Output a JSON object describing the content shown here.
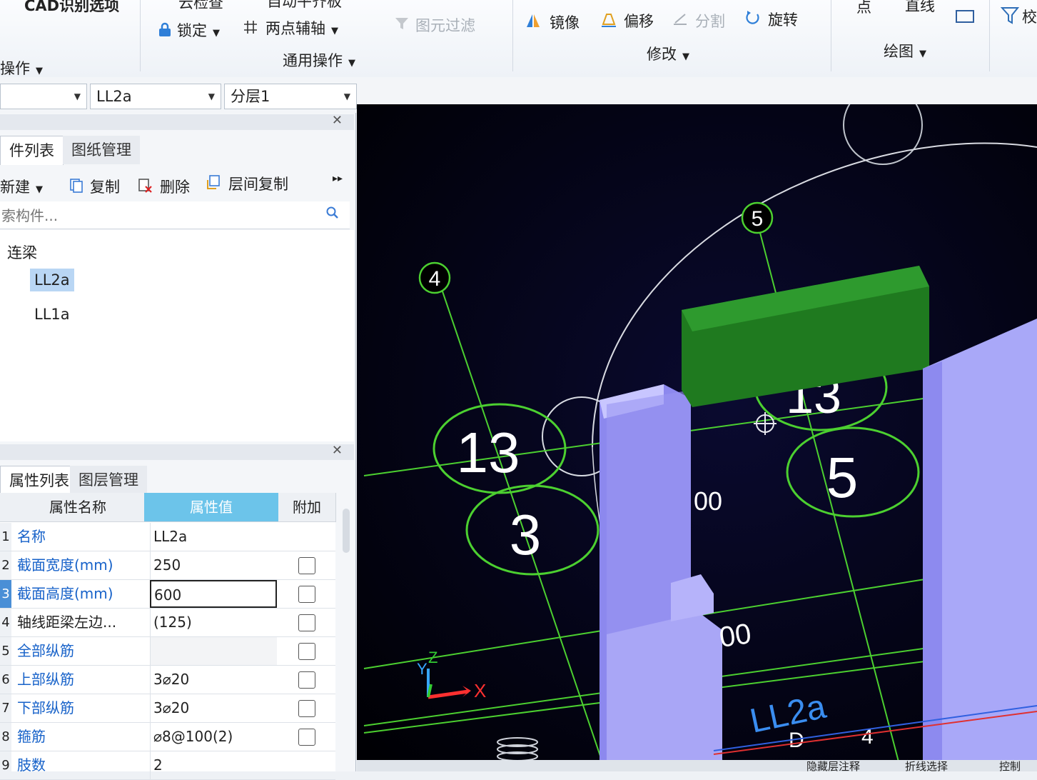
{
  "ribbon": {
    "partial_top_left": "CAD识别选项",
    "partial_top_check": "云检查",
    "partial_top_auto": "自动平齐板",
    "group_left_label": "操作",
    "lock_label": "锁定",
    "two_point_axis_label": "两点辅轴",
    "general_ops_label": "通用操作",
    "filter_label": "图元过滤",
    "mirror_label": "镜像",
    "offset_label": "偏移",
    "split_label": "分割",
    "rotate_label": "旋转",
    "modify_label": "修改",
    "point_label": "点",
    "line_label": "直线",
    "draw_label": "绘图",
    "partial_right_label": "校"
  },
  "selectors": {
    "combo1": "",
    "combo2": "LL2a",
    "combo3": "分层1"
  },
  "component_panel": {
    "tab_active": "件列表",
    "tab_inactive": "图纸管理",
    "new_label": "新建",
    "copy_label": "复制",
    "delete_label": "删除",
    "floor_copy_label": "层间复制",
    "search_placeholder": "索构件...",
    "category": "连梁",
    "items": [
      "LL2a",
      "LL1a"
    ]
  },
  "property_panel": {
    "tab_active": "属性列表",
    "tab_inactive": "图层管理",
    "col_name": "属性名称",
    "col_value": "属性值",
    "col_extra": "附加",
    "rows": [
      {
        "num": "1",
        "name": "名称",
        "value": ""
      },
      {
        "num": "2",
        "name": "截面宽度(mm)",
        "value": "250"
      },
      {
        "num": "3",
        "name": "截面高度(mm)",
        "value": "600"
      },
      {
        "num": "4",
        "name": "轴线距梁左边...",
        "value": "(125)"
      },
      {
        "num": "5",
        "name": "全部纵筋",
        "value": ""
      },
      {
        "num": "6",
        "name": "上部纵筋",
        "value": "3⌀20"
      },
      {
        "num": "7",
        "name": "下部纵筋",
        "value": "3⌀20"
      },
      {
        "num": "8",
        "name": "箍筋",
        "value": "⌀8@100(2)"
      },
      {
        "num": "9",
        "name": "肢数",
        "value": "2"
      }
    ],
    "name_value": "LL2a"
  },
  "viewport": {
    "axis_labels": [
      "4",
      "5",
      "13",
      "3",
      "5",
      "13"
    ],
    "dim_text_1": "00",
    "dim_text_2": "00",
    "beam_label": "LL2a",
    "axis_d": "D",
    "axis_4": "4",
    "ucs_x": "X",
    "ucs_y": "Y",
    "ucs_z": "Z",
    "status_items": [
      "隐藏层注释",
      "折线选择",
      "控制"
    ]
  }
}
